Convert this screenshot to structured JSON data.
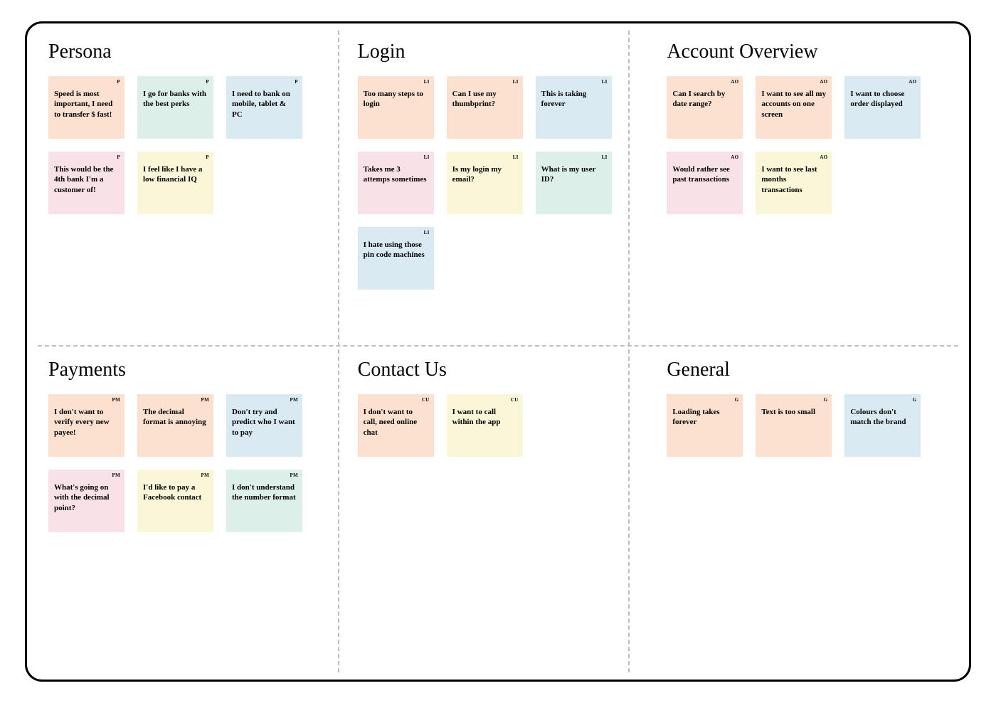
{
  "colors": {
    "peach": "#fde1d0",
    "mint": "#dcefe8",
    "blue": "#daeaf2",
    "pink": "#f9e1e8",
    "butter": "#faf6d8"
  },
  "sections": [
    {
      "id": "persona",
      "title": "Persona",
      "tag": "P",
      "notes": [
        {
          "text": "Speed is most important, I need to transfer $ fast!",
          "color": "peach"
        },
        {
          "text": "I go for banks with the best perks",
          "color": "mint"
        },
        {
          "text": "I need to bank on mobile, tablet & PC",
          "color": "blue"
        },
        {
          "text": "This would be the 4th bank I'm a customer of!",
          "color": "pink"
        },
        {
          "text": "I feel like I have a low financial IQ",
          "color": "butter"
        }
      ]
    },
    {
      "id": "login",
      "title": "Login",
      "tag": "LI",
      "notes": [
        {
          "text": "Too many steps to login",
          "color": "peach"
        },
        {
          "text": "Can I use my thumbprint?",
          "color": "peach"
        },
        {
          "text": "This is taking forever",
          "color": "blue"
        },
        {
          "text": "Takes me 3 attemps sometimes",
          "color": "pink"
        },
        {
          "text": "Is my login my email?",
          "color": "butter"
        },
        {
          "text": "What is my user ID?",
          "color": "mint"
        },
        {
          "text": "I hate using those pin code machines",
          "color": "blue"
        }
      ]
    },
    {
      "id": "account-overview",
      "title": "Account Overview",
      "tag": "AO",
      "notes": [
        {
          "text": "Can I search by date range?",
          "color": "peach"
        },
        {
          "text": "I want to see all my accounts on one screen",
          "color": "peach"
        },
        {
          "text": "I want to choose order displayed",
          "color": "blue"
        },
        {
          "text": "Would rather see past transactions",
          "color": "pink"
        },
        {
          "text": "I want to see last months transactions",
          "color": "butter"
        }
      ]
    },
    {
      "id": "payments",
      "title": "Payments",
      "tag": "PM",
      "notes": [
        {
          "text": "I don't want to verify every new payee!",
          "color": "peach"
        },
        {
          "text": "The decimal format is annoying",
          "color": "peach"
        },
        {
          "text": "Don't try and predict who I want to pay",
          "color": "blue"
        },
        {
          "text": "What's going on with the decimal point?",
          "color": "pink"
        },
        {
          "text": "I'd like to pay a Facebook contact",
          "color": "butter"
        },
        {
          "text": "I don't understand the number format",
          "color": "mint"
        }
      ]
    },
    {
      "id": "contact-us",
      "title": "Contact Us",
      "tag": "CU",
      "notes": [
        {
          "text": "I don't want to call, need online chat",
          "color": "peach"
        },
        {
          "text": "I want to call within the app",
          "color": "butter"
        }
      ]
    },
    {
      "id": "general",
      "title": "General",
      "tag": "G",
      "notes": [
        {
          "text": "Loading takes forever",
          "color": "peach"
        },
        {
          "text": "Text is too small",
          "color": "peach"
        },
        {
          "text": "Colours don't match the brand",
          "color": "blue"
        }
      ]
    }
  ]
}
